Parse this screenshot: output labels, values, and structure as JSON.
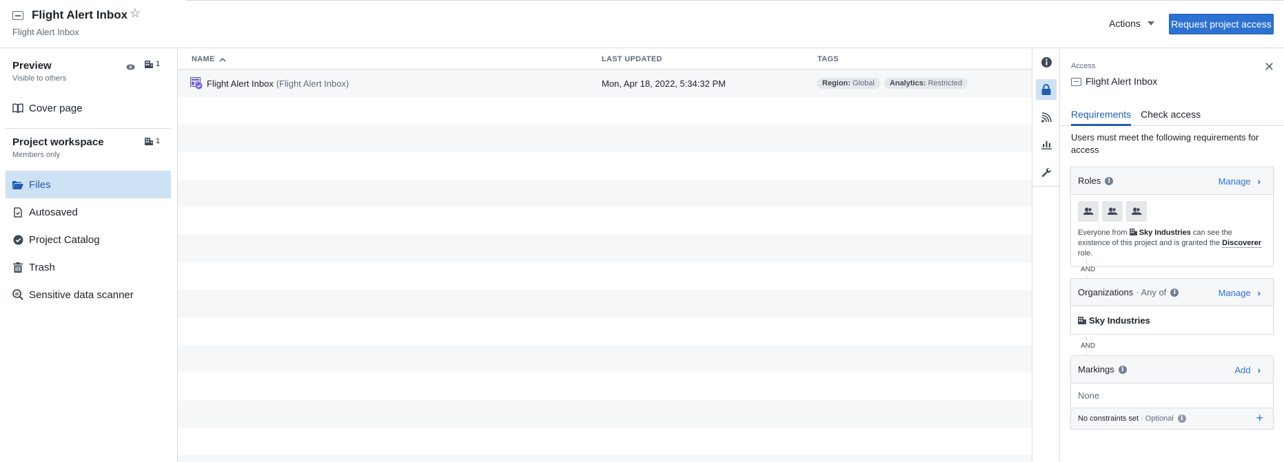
{
  "header": {
    "title": "Flight Alert Inbox",
    "subtitle": "Flight Alert Inbox",
    "actions_label": "Actions",
    "request_button": "Request project access"
  },
  "sidebar": {
    "preview": {
      "title": "Preview",
      "subtitle": "Visible to others",
      "org_count": "1"
    },
    "cover_page": "Cover page",
    "workspace": {
      "title": "Project workspace",
      "subtitle": "Members only",
      "org_count": "1"
    },
    "items": [
      {
        "label": "Files",
        "icon": "folder-open-icon",
        "active": true
      },
      {
        "label": "Autosaved",
        "icon": "document-check-icon",
        "active": false
      },
      {
        "label": "Project Catalog",
        "icon": "badge-check-icon",
        "active": false
      },
      {
        "label": "Trash",
        "icon": "trash-icon",
        "active": false
      },
      {
        "label": "Sensitive data scanner",
        "icon": "search-scan-icon",
        "active": false
      }
    ]
  },
  "table": {
    "columns": {
      "name": "NAME",
      "last_updated": "LAST UPDATED",
      "tags": "TAGS"
    },
    "sort": {
      "column": "name",
      "direction": "ascending"
    },
    "rows": [
      {
        "name": "Flight Alert Inbox",
        "alias": "(Flight Alert Inbox)",
        "last_updated": "Mon, Apr 18, 2022, 5:34:32 PM",
        "tags": [
          {
            "key": "Region",
            "value": "Global"
          },
          {
            "key": "Analytics",
            "value": "Restricted"
          }
        ]
      }
    ]
  },
  "rail": {
    "items": [
      {
        "icon": "info-icon",
        "active": false
      },
      {
        "icon": "lock-icon",
        "active": true
      },
      {
        "icon": "feed-icon",
        "active": false
      },
      {
        "icon": "chart-icon",
        "active": false
      },
      {
        "icon": "wrench-icon",
        "active": false
      }
    ]
  },
  "panel": {
    "eyebrow": "Access",
    "title": "Flight Alert Inbox",
    "tabs": [
      {
        "label": "Requirements",
        "active": true
      },
      {
        "label": "Check access",
        "active": false
      }
    ],
    "description": "Users must meet the following requirements for access",
    "roles": {
      "title": "Roles",
      "action": "Manage",
      "text_prefix": "Everyone from",
      "org": "Sky Industries",
      "text_middle": "can see the existence of this project and is granted the",
      "role": "Discoverer",
      "text_suffix": "role."
    },
    "and_label": "AND",
    "organizations": {
      "title": "Organizations",
      "qualifier": "· Any of",
      "action": "Manage",
      "items": [
        "Sky Industries"
      ]
    },
    "markings": {
      "title": "Markings",
      "action": "Add",
      "value": "None",
      "constraints": "No constraints set",
      "constraints_qualifier": "· Optional"
    }
  },
  "colors": {
    "primary": "#2d72d2",
    "active_bg": "#cde2f4",
    "active_text": "#215db0",
    "muted_text": "#5f6b7c",
    "stripe": "#f6f7f9"
  }
}
